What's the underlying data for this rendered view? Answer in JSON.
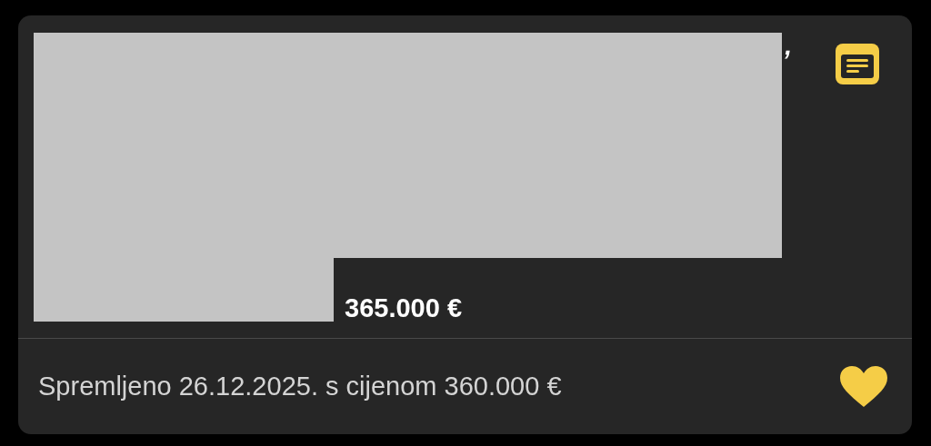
{
  "listing": {
    "redacted": true,
    "title_visible": ",",
    "price": "365.000 €"
  },
  "saved": {
    "text": "Spremljeno 26.12.2025. s cijenom 360.000 €",
    "favorite": true
  }
}
